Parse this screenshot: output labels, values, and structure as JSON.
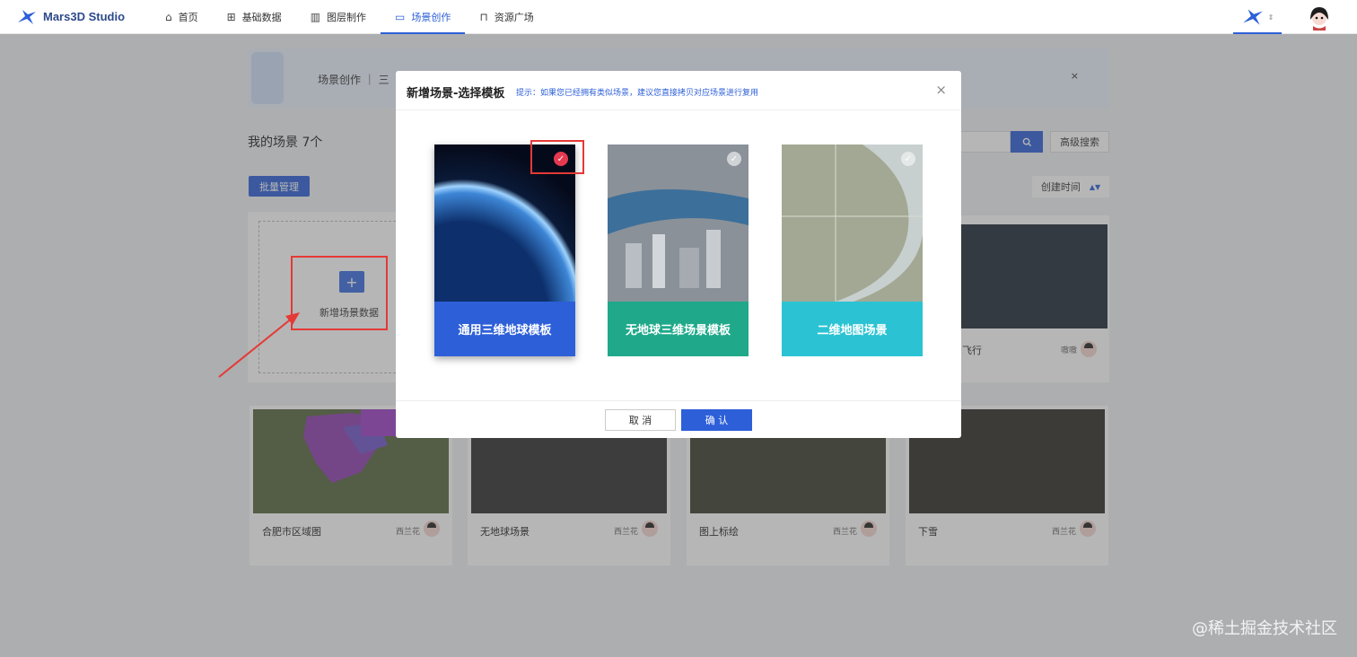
{
  "app": {
    "name": "Mars3D Studio"
  },
  "nav": {
    "items": [
      {
        "label": "首页",
        "icon": "home-icon"
      },
      {
        "label": "基础数据",
        "icon": "grid-icon"
      },
      {
        "label": "图层制作",
        "icon": "layers-icon"
      },
      {
        "label": "场景创作",
        "icon": "video-icon",
        "active": true
      },
      {
        "label": "资源广场",
        "icon": "bag-icon"
      }
    ]
  },
  "banner": {
    "text": "场景创作 ｜ 三",
    "close": "×"
  },
  "page": {
    "my_scenes": "我的场景  7个",
    "search_button_icon": "search-icon",
    "advanced_search": "高级搜索",
    "batch_manage": "批量管理",
    "sort_label": "创建时间",
    "add_scene_label": "新增场景数据"
  },
  "cards": [
    {
      "title": "飞行",
      "author": "嗷嗷"
    },
    {
      "title": "合肥市区域图",
      "author": "西兰花"
    },
    {
      "title": "无地球场景",
      "author": "西兰花"
    },
    {
      "title": "图上标绘",
      "author": "西兰花"
    },
    {
      "title": "下雪",
      "author": "西兰花"
    }
  ],
  "modal": {
    "title": "新增场景-选择模板",
    "hint": "提示：如果您已经拥有类似场景，建议您直接拷贝对应场景进行复用",
    "close": "×",
    "templates": [
      {
        "label": "通用三维地球模板",
        "color": "#2d5fd8",
        "selected": true
      },
      {
        "label": "无地球三维场景模板",
        "color": "#1fa98a",
        "selected": false
      },
      {
        "label": "二维地图场景",
        "color": "#2bc3d3",
        "selected": false
      }
    ],
    "cancel": "取 消",
    "confirm": "确 认"
  },
  "watermark": "@稀土掘金技术社区"
}
